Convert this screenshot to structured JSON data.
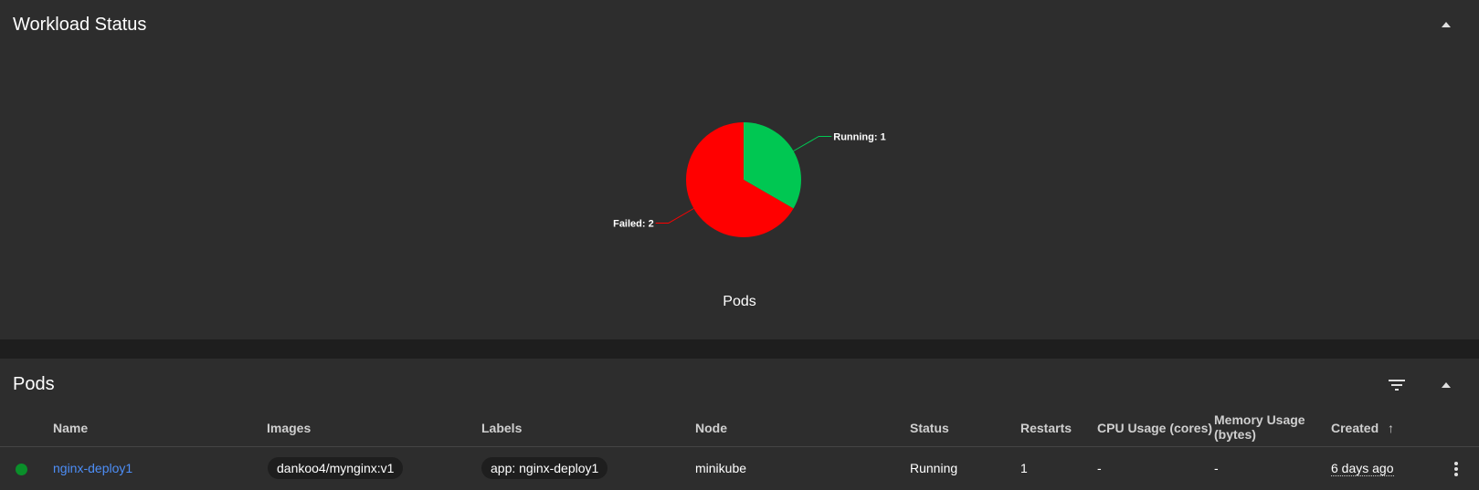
{
  "workload": {
    "title": "Workload Status",
    "chart_data": {
      "type": "pie",
      "title": "Pods",
      "slices": [
        {
          "label": "Running: 1",
          "name": "Running",
          "value": 1,
          "color": "#00c752"
        },
        {
          "label": "Failed: 2",
          "name": "Failed",
          "value": 2,
          "color": "#ff0000"
        }
      ]
    }
  },
  "pods": {
    "title": "Pods",
    "columns": {
      "name": "Name",
      "images": "Images",
      "labels": "Labels",
      "node": "Node",
      "status": "Status",
      "restarts": "Restarts",
      "cpu": "CPU Usage (cores)",
      "memory_line1": "Memory Usage",
      "memory_line2": "(bytes)",
      "created": "Created",
      "sort_arrow": "↑"
    },
    "rows": [
      {
        "status_color": "#0a8f2a",
        "name": "nginx-deploy1",
        "image": "dankoo4/mynginx:v1",
        "label": "app: nginx-deploy1",
        "node": "minikube",
        "status": "Running",
        "restarts": "1",
        "cpu": "-",
        "memory": "-",
        "created": "6 days ago"
      }
    ]
  }
}
